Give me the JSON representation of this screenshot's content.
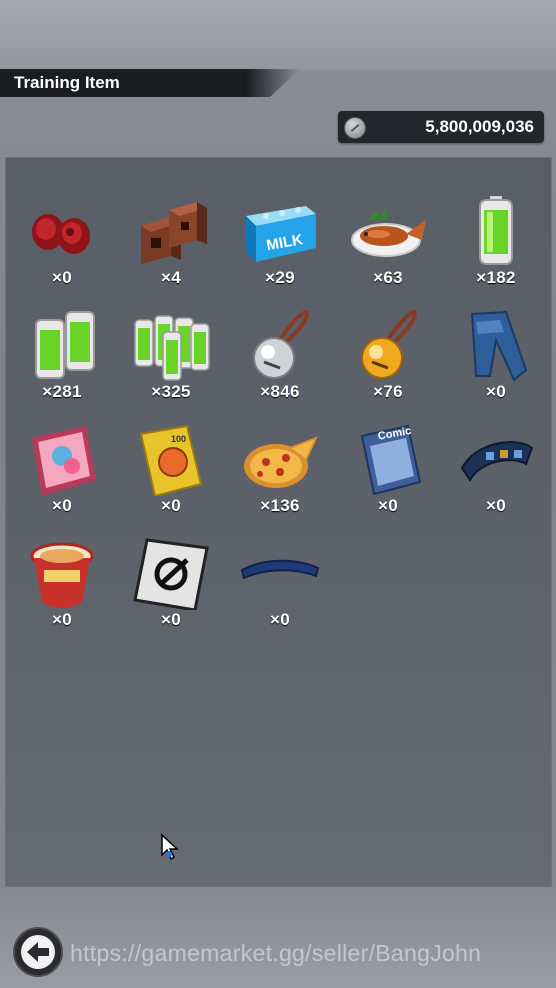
{
  "header": {
    "title": "Training Item"
  },
  "currency": {
    "icon": "coin-icon",
    "value": "5,800,009,036"
  },
  "items": [
    {
      "name": "dumbbell-weights",
      "count": "×0"
    },
    {
      "name": "brick-blocks",
      "count": "×4"
    },
    {
      "name": "milk-carton",
      "count": "×29"
    },
    {
      "name": "grilled-fish",
      "count": "×63"
    },
    {
      "name": "energy-battery",
      "count": "×182"
    },
    {
      "name": "double-battery-pack",
      "count": "×281"
    },
    {
      "name": "battery-bundle",
      "count": "×325"
    },
    {
      "name": "silver-bell",
      "count": "×846"
    },
    {
      "name": "gold-bell",
      "count": "×76"
    },
    {
      "name": "blue-jeans",
      "count": "×0"
    },
    {
      "name": "magazine",
      "count": "×0"
    },
    {
      "name": "cookbook",
      "count": "×0"
    },
    {
      "name": "pizza",
      "count": "×136"
    },
    {
      "name": "comic-book",
      "count": "×0"
    },
    {
      "name": "wrist-band",
      "count": "×0"
    },
    {
      "name": "ramen-cup",
      "count": "×0"
    },
    {
      "name": "emblem-card",
      "count": "×0"
    },
    {
      "name": "headband",
      "count": "×0"
    }
  ],
  "watermark": "https://gamemarket.gg/seller/BangJohn",
  "labels": {
    "milk": "MILK",
    "comic": "Comic",
    "cookbook": "100"
  }
}
